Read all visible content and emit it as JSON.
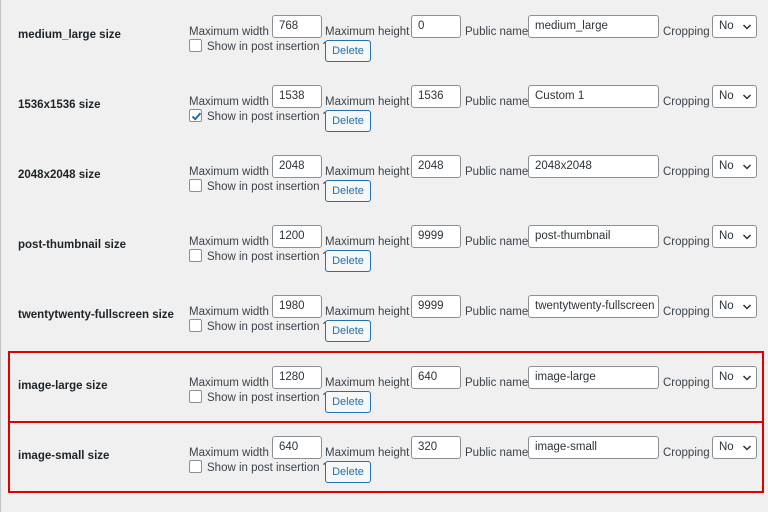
{
  "labels": {
    "max_width": "Maximum width",
    "max_height": "Maximum height",
    "public_name": "Public name",
    "cropping": "Cropping",
    "show_in_post": "Show in post insertion ?",
    "delete": "Delete"
  },
  "icons": {
    "select_arrow": "chevron-down-icon",
    "checked": "checkmark-icon"
  },
  "colors": {
    "highlight": "#e00000",
    "accent": "#2271b1"
  },
  "sizes": [
    {
      "name": "medium_large size",
      "width": "768",
      "height": "0",
      "public_name": "medium_large",
      "cropping": "No",
      "show_in_post": false,
      "highlighted": false
    },
    {
      "name": "1536x1536 size",
      "width": "1538",
      "height": "1536",
      "public_name": "Custom 1",
      "cropping": "No",
      "show_in_post": true,
      "highlighted": false
    },
    {
      "name": "2048x2048 size",
      "width": "2048",
      "height": "2048",
      "public_name": "2048x2048",
      "cropping": "No",
      "show_in_post": false,
      "highlighted": false
    },
    {
      "name": "post-thumbnail size",
      "width": "1200",
      "height": "9999",
      "public_name": "post-thumbnail",
      "cropping": "No",
      "show_in_post": false,
      "highlighted": false
    },
    {
      "name": "twentytwenty-fullscreen size",
      "width": "1980",
      "height": "9999",
      "public_name": "twentytwenty-fullscreen",
      "cropping": "No",
      "show_in_post": false,
      "highlighted": false
    },
    {
      "name": "image-large size",
      "width": "1280",
      "height": "640",
      "public_name": "image-large",
      "cropping": "No",
      "show_in_post": false,
      "highlighted": true
    },
    {
      "name": "image-small size",
      "width": "640",
      "height": "320",
      "public_name": "image-small",
      "cropping": "No",
      "show_in_post": false,
      "highlighted": true
    }
  ]
}
